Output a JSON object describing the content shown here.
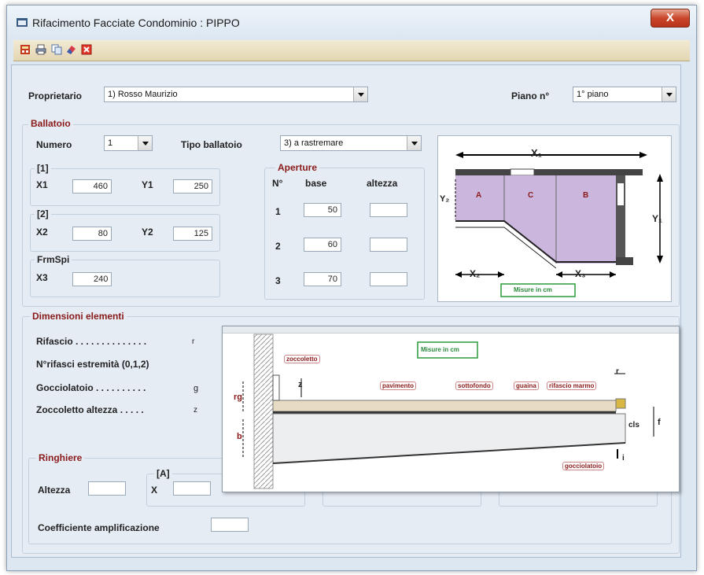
{
  "window": {
    "title": "Rifacimento Facciate Condominio : PIPPO",
    "close_label": "X"
  },
  "toolbar": {
    "icons": [
      "calculator-icon",
      "print-icon",
      "copy-icon",
      "eraser-icon",
      "close-icon"
    ]
  },
  "owner": {
    "label": "Proprietario",
    "value": "1) Rosso Maurizio"
  },
  "floor": {
    "label": "Piano n°",
    "value": "1° piano"
  },
  "ballatoio": {
    "title": "Ballatoio",
    "numero_label": "Numero",
    "numero_value": "1",
    "tipo_label": "Tipo ballatoio",
    "tipo_value": "3) a rastremare",
    "g1_title": "[1]",
    "x1_label": "X1",
    "x1_value": "460",
    "y1_label": "Y1",
    "y1_value": "250",
    "g2_title": "[2]",
    "x2_label": "X2",
    "x2_value": "80",
    "y2_label": "Y2",
    "y2_value": "125",
    "g3_title": "FrmSpi",
    "x3_label": "X3",
    "x3_value": "240"
  },
  "aperture": {
    "title": "Aperture",
    "col_n": "N°",
    "col_base": "base",
    "col_altezza": "altezza",
    "rows": [
      {
        "n": "1",
        "base": "50",
        "altezza": ""
      },
      {
        "n": "2",
        "base": "60",
        "altezza": ""
      },
      {
        "n": "3",
        "base": "70",
        "altezza": ""
      }
    ]
  },
  "diagram1": {
    "x1": "X₁",
    "y1": "Y₁",
    "y2": "Y₂",
    "x2": "X₂",
    "x3": "X₃",
    "a": "A",
    "b": "B",
    "c": "C",
    "note": "Misure in cm"
  },
  "dimensioni": {
    "title": "Dimensioni elementi",
    "rifascio": "Rifascio . . . . . . . . . . . . . .",
    "rifascio_sym": "r",
    "rifasci_estremita": "N°rifasci estremità (0,1,2)",
    "gocciolatoio": "Gocciolatoio . . . . . . . . . .",
    "gocciolatoio_sym": "g",
    "zoccoletto": "Zoccoletto altezza . . . . .",
    "zoccoletto_sym": "z"
  },
  "diagram2": {
    "note": "Misure in cm",
    "zoccoletto": "zoccoletto",
    "pavimento": "pavimento",
    "sottofondo": "sottofondo",
    "guaina": "guaina",
    "rifascio_marmo": "rifascio marmo",
    "gocciolatoio": "gocciolatoio",
    "rg": "rg",
    "z": "z",
    "b": "b",
    "r": "r",
    "f": "f",
    "cls": "cls",
    "i": "i"
  },
  "ringhiere": {
    "title": "Ringhiere",
    "altezza_label": "Altezza",
    "altezza_value": "",
    "group_a": "[A]",
    "x_label": "X",
    "coeff_label": "Coefficiente amplificazione",
    "coeff_value": ""
  }
}
